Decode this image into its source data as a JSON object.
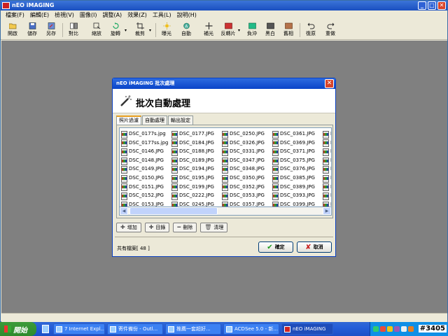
{
  "window": {
    "title": "nEO iMAGING",
    "minimize": "_",
    "maximize": "□",
    "close": "✕"
  },
  "menus": [
    "檔案(F)",
    "編輯(E)",
    "檢視(V)",
    "圖像(I)",
    "調整(A)",
    "效果(Z)",
    "工具(L)",
    "說明(H)"
  ],
  "toolbar": [
    "開啟",
    "儲存",
    "另存",
    "對比",
    "縮放",
    "旋轉",
    "裁剪",
    "曝光",
    "自動",
    "補光",
    "反轉片",
    "負沖",
    "黑白",
    "舊相",
    "復原",
    "重做"
  ],
  "toolbar_icons": [
    "folder-open-icon",
    "save-icon",
    "save-as-icon",
    "compare-icon",
    "zoom-icon",
    "rotate-icon",
    "crop-icon",
    "exposure-icon",
    "auto-icon",
    "fill-light-icon",
    "reverse-film-icon",
    "negative-icon",
    "black-white-icon",
    "old-photo-icon",
    "undo-icon",
    "redo-icon"
  ],
  "dialog": {
    "title": "nEO iMAGING 批次處理",
    "close": "✕",
    "header": "批次自動處理",
    "tabs": [
      "照片過濾",
      "自動處理",
      "輸出設定"
    ],
    "files": [
      [
        "DSC_0177s.jpg",
        "DSC_0177ss.jpg",
        "DSC_0146.JPG",
        "DSC_0148.JPG",
        "DSC_0149.JPG",
        "DSC_0150.JPG",
        "DSC_0151.JPG",
        "DSC_0152.JPG",
        "DSC_0153.JPG"
      ],
      [
        "DSC_0177.JPG",
        "DSC_0184.JPG",
        "DSC_0188.JPG",
        "DSC_0189.JPG",
        "DSC_0194.JPG",
        "DSC_0195.JPG",
        "DSC_0199.JPG",
        "DSC_0222.JPG",
        "DSC_0245.JPG"
      ],
      [
        "DSC_0250.JPG",
        "DSC_0326.JPG",
        "DSC_0331.JPG",
        "DSC_0347.JPG",
        "DSC_0348.JPG",
        "DSC_0350.JPG",
        "DSC_0352.JPG",
        "DSC_0353.JPG",
        "DSC_0357.JPG"
      ],
      [
        "DSC_0361.JPG",
        "DSC_0369.JPG",
        "DSC_0371.JPG",
        "DSC_0375.JPG",
        "DSC_0376.JPG",
        "DSC_0385.JPG",
        "DSC_0389.JPG",
        "DSC_0393.JPG",
        "DSC_0399.JPG"
      ],
      [
        "D",
        "D",
        "D",
        "D",
        "D",
        "D",
        "D",
        "D",
        "D"
      ]
    ],
    "buttons": {
      "add": "增加",
      "folder": "目錄",
      "delete": "刪除",
      "clear": "清理"
    },
    "count_label": "共有檔案[ 48 ]",
    "ok": "確定",
    "cancel": "取消"
  },
  "taskbar": {
    "start": "開始",
    "tasks": [
      "7 Internet Expl...",
      "寄件備份 - Outl...",
      "推薦一套超好...",
      "ACDSee 5.0 - 新...",
      "nEO iMAGING"
    ]
  },
  "watermark": "#3405",
  "colors": {
    "titlebar": "#1a4fc0",
    "taskbar": "#245ed8",
    "start": "#2f8a2c",
    "workspace": "#808080"
  }
}
